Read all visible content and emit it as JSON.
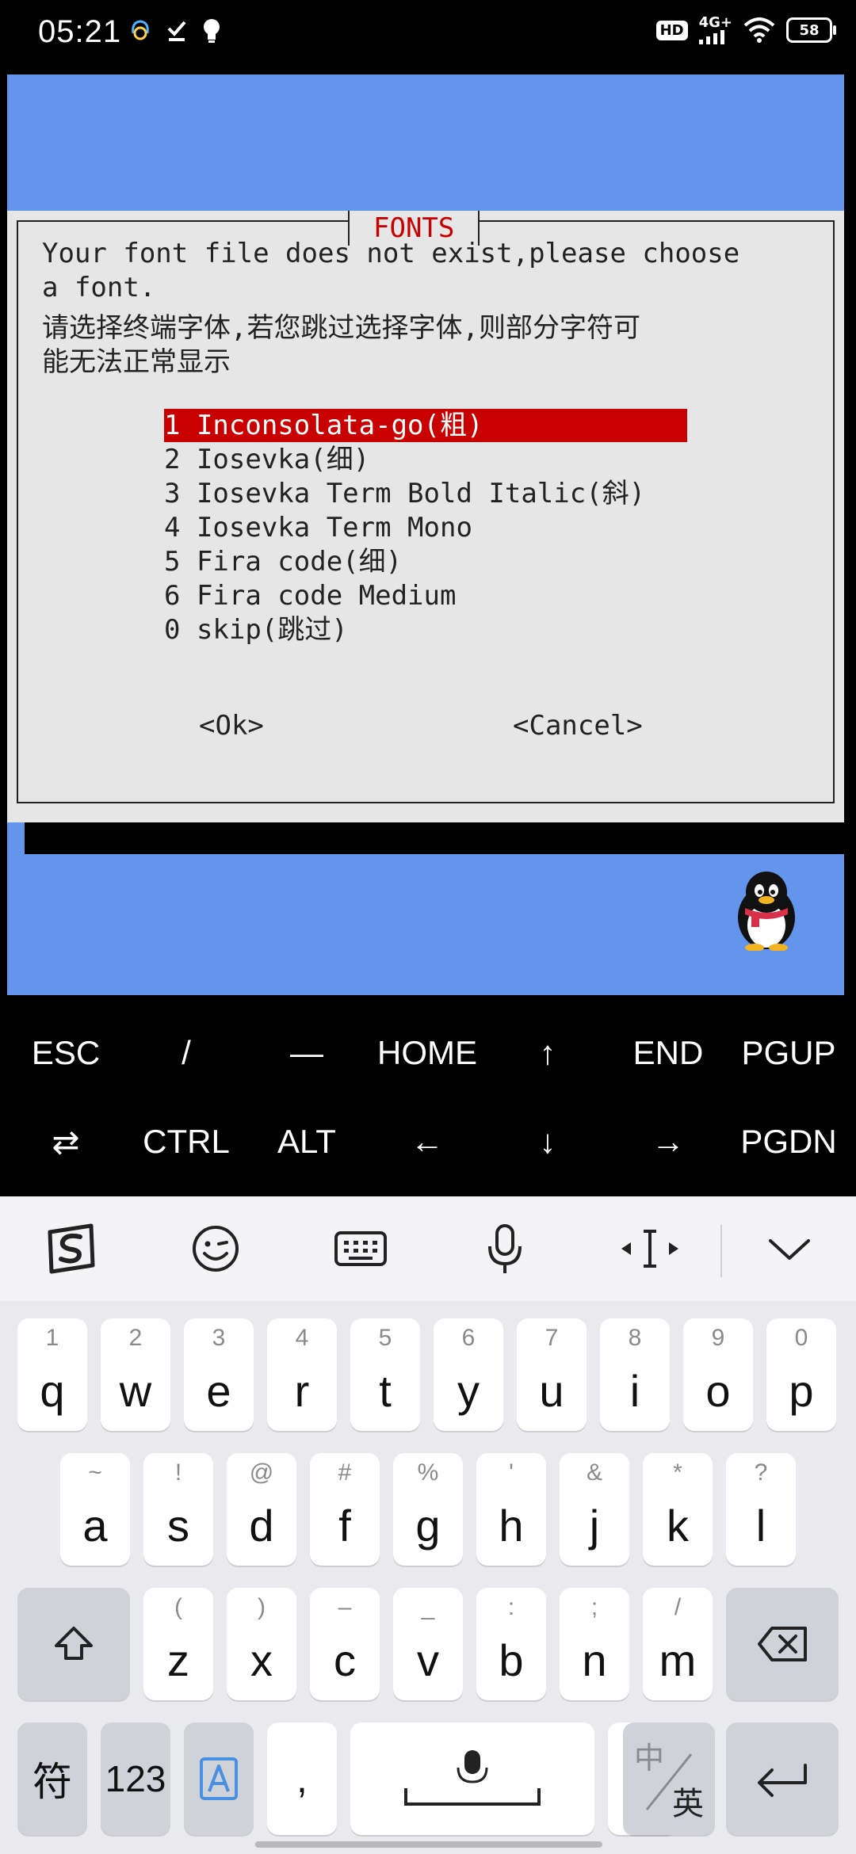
{
  "status_bar": {
    "time": "05:21",
    "hd": "HD",
    "network": "4G+",
    "battery": "58",
    "left_icons": [
      "headset-icon",
      "check-icon",
      "bulb-icon"
    ]
  },
  "dialog": {
    "title": "FONTS",
    "message": [
      "Your font file does not exist,please choose",
      "a font.",
      "请选择终端字体,若您跳过选择字体,则部分字符可",
      "能无法正常显示"
    ],
    "options": [
      "1 Inconsolata-go(粗)",
      "2 Iosevka(细)",
      "3 Iosevka Term Bold Italic(斜)",
      "4 Iosevka Term Mono",
      "5 Fira code(细)",
      "6 Fira code Medium",
      "0 skip(跳过)"
    ],
    "selected_index": 0,
    "ok_label": "<Ok>",
    "cancel_label": "<Cancel>"
  },
  "extra_keys": {
    "row1": [
      "ESC",
      "/",
      "—",
      "HOME",
      "↑",
      "END",
      "PGUP"
    ],
    "row2": [
      "⇄",
      "CTRL",
      "ALT",
      "←",
      "↓",
      "→",
      "PGDN"
    ]
  },
  "keyboard": {
    "row1": [
      {
        "hint": "1",
        "key": "q"
      },
      {
        "hint": "2",
        "key": "w"
      },
      {
        "hint": "3",
        "key": "e"
      },
      {
        "hint": "4",
        "key": "r"
      },
      {
        "hint": "5",
        "key": "t"
      },
      {
        "hint": "6",
        "key": "y"
      },
      {
        "hint": "7",
        "key": "u"
      },
      {
        "hint": "8",
        "key": "i"
      },
      {
        "hint": "9",
        "key": "o"
      },
      {
        "hint": "0",
        "key": "p"
      }
    ],
    "row2": [
      {
        "hint": "~",
        "key": "a"
      },
      {
        "hint": "!",
        "key": "s"
      },
      {
        "hint": "@",
        "key": "d"
      },
      {
        "hint": "#",
        "key": "f"
      },
      {
        "hint": "%",
        "key": "g"
      },
      {
        "hint": "'",
        "key": "h"
      },
      {
        "hint": "&",
        "key": "j"
      },
      {
        "hint": "*",
        "key": "k"
      },
      {
        "hint": "?",
        "key": "l"
      }
    ],
    "row3": [
      {
        "hint": "(",
        "key": "z"
      },
      {
        "hint": ")",
        "key": "x"
      },
      {
        "hint": "–",
        "key": "c"
      },
      {
        "hint": "_",
        "key": "v"
      },
      {
        "hint": ":",
        "key": "b"
      },
      {
        "hint": ";",
        "key": "n"
      },
      {
        "hint": "/",
        "key": "m"
      }
    ],
    "symbols_key": "符",
    "numbers_key": "123",
    "comma_key": ",",
    "period_key": ".",
    "lang_key_top": "中",
    "lang_key_bottom": "英"
  },
  "colors": {
    "terminal_blue": "#6495ed",
    "dialog_bg": "#e6e6e6",
    "highlight_red": "#c80000"
  }
}
